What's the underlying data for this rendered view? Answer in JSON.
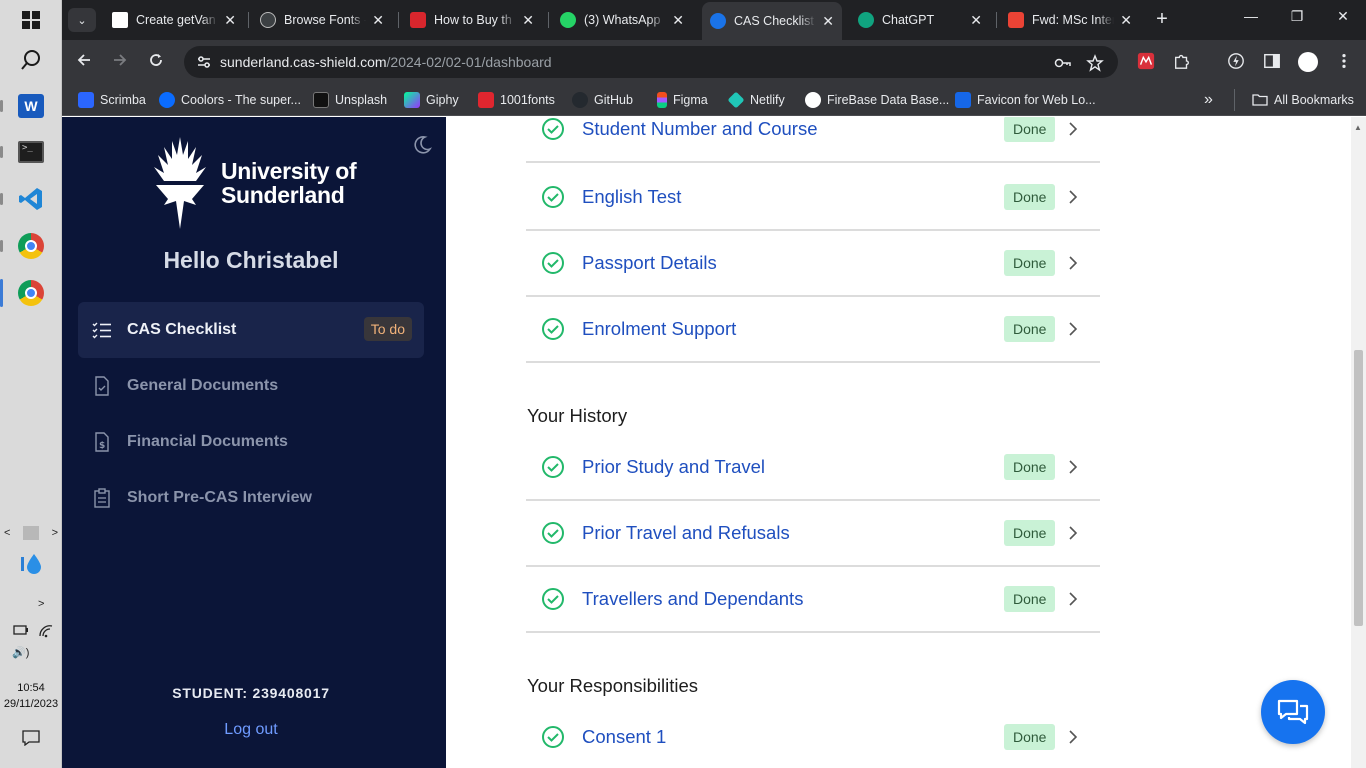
{
  "taskbar": {
    "clock_time": "10:54",
    "clock_date": "29/11/2023",
    "scroll_left": "<",
    "scroll_right": ">",
    "expand": ">",
    "volume": "🔊)"
  },
  "browser": {
    "tabs": [
      {
        "title": "Create getVan",
        "close": "✕"
      },
      {
        "title": "Browse Fonts -",
        "close": "✕"
      },
      {
        "title": "How to Buy th",
        "close": "✕"
      },
      {
        "title": "(3) WhatsApp",
        "close": "✕"
      },
      {
        "title": "CAS Checklist",
        "close": "✕"
      },
      {
        "title": "ChatGPT",
        "close": "✕"
      },
      {
        "title": "Fwd: MSc Inter",
        "close": "✕"
      }
    ],
    "tab_menu": "⌄",
    "newtab": "+",
    "window_controls": {
      "minimize": "—",
      "restore": "❐",
      "close": "✕"
    },
    "url_host": "sunderland.cas-shield.com",
    "url_path": "/2024-02/02-01/dashboard",
    "bookmarks": [
      {
        "label": "Scrimba",
        "color": "#2b66ff"
      },
      {
        "label": "Coolors - The super...",
        "color": "#0a6cff"
      },
      {
        "label": "Unsplash",
        "color": "#111111"
      },
      {
        "label": "Giphy",
        "color": "#8c4bff"
      },
      {
        "label": "1001fonts",
        "color": "#e0262f"
      },
      {
        "label": "GitHub",
        "color": "#24292f"
      },
      {
        "label": "Figma",
        "color": "#f24e1e"
      },
      {
        "label": "Netlify",
        "color": "#20c6b7"
      },
      {
        "label": "FireBase Data Base...",
        "color": "#ffffff"
      },
      {
        "label": "Favicon for Web Lo...",
        "color": "#1667e8"
      }
    ],
    "bookmarks_more": "»",
    "all_bookmarks": "All Bookmarks"
  },
  "sidebar": {
    "logo_line1": "University of",
    "logo_line2": "Sunderland",
    "greeting": "Hello Christabel",
    "nav": [
      {
        "label": "CAS Checklist",
        "badge": "To do",
        "active": true
      },
      {
        "label": "General Documents"
      },
      {
        "label": "Financial Documents"
      },
      {
        "label": "Short Pre-CAS Interview"
      }
    ],
    "student_id": "STUDENT: 239408017",
    "logout": "Log out"
  },
  "checklist": {
    "items_top": [
      {
        "label": "Student Number and Course",
        "status": "Done"
      },
      {
        "label": "English Test",
        "status": "Done"
      },
      {
        "label": "Passport Details",
        "status": "Done"
      },
      {
        "label": "Enrolment Support",
        "status": "Done"
      }
    ],
    "history_title": "Your History",
    "history": [
      {
        "label": "Prior Study and Travel",
        "status": "Done"
      },
      {
        "label": "Prior Travel and Refusals",
        "status": "Done"
      },
      {
        "label": "Travellers and Dependants",
        "status": "Done"
      }
    ],
    "responsibilities_title": "Your Responsibilities",
    "responsibilities": [
      {
        "label": "Consent 1",
        "status": "Done"
      }
    ]
  },
  "colors": {
    "sidebar_bg": "#0b1538",
    "link_blue": "#1f4fbf",
    "done_bg": "#c9f2d6",
    "check_green": "#22b86a",
    "fab_blue": "#1673ef"
  }
}
